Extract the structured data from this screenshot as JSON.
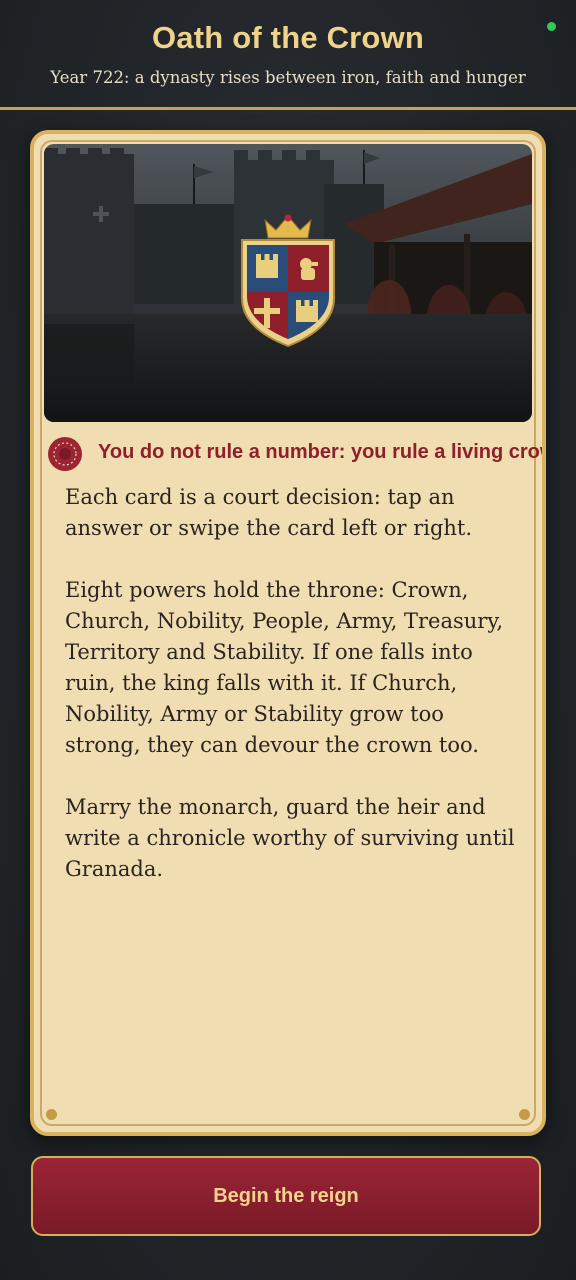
{
  "header": {
    "title": "Oath of the Crown",
    "subtitle": "Year 722: a dynasty rises between iron, faith and hunger"
  },
  "card": {
    "artwork_icon": "royal-coat-of-arms",
    "tagline_icon": "crown-seal-icon",
    "tagline": "You do not rule a number: you rule a living crown.",
    "paragraphs": [
      "Each card is a court decision: tap an answer or swipe the card left or right.",
      "Eight powers hold the throne: Crown, Church, Nobility, People, Army, Treasury, Territory and Stability. If one falls into ruin, the king falls with it. If Church, Nobility, Army or Stability grow too strong, they can devour the crown too.",
      "Marry the monarch, guard the heir and write a chronicle worthy of surviving until Granada."
    ]
  },
  "actions": {
    "begin_label": "Begin the reign"
  },
  "colors": {
    "accent_gold": "#efd38a",
    "card_parchment": "#f0ddb2",
    "crimson": "#8e1f2b",
    "button": "#8a1f2e"
  }
}
